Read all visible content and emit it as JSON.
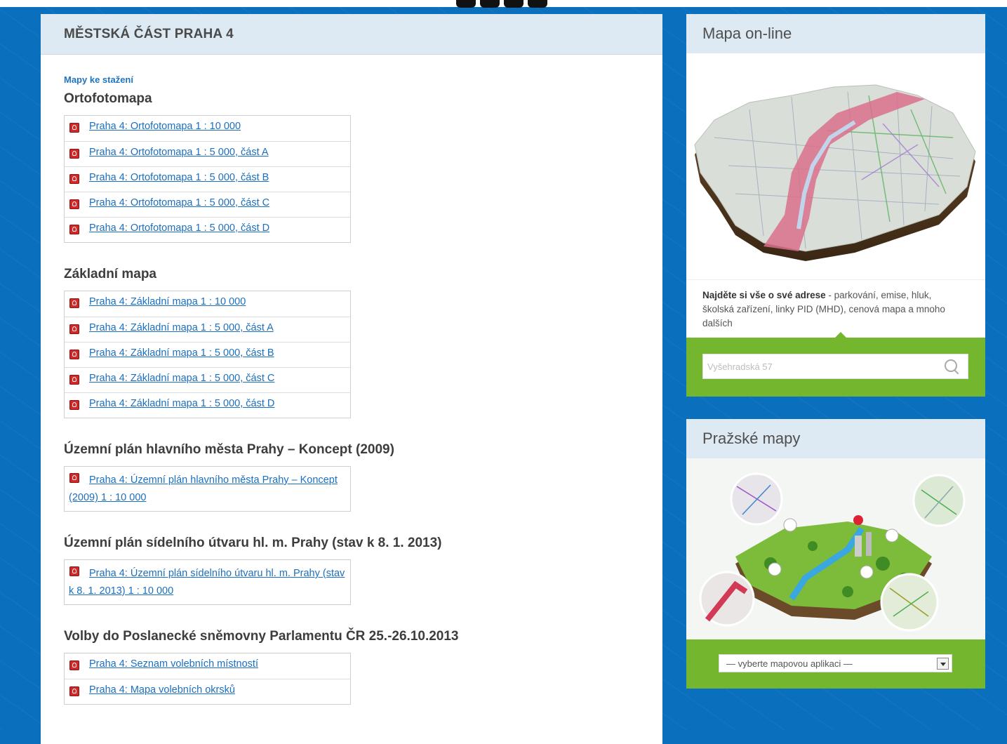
{
  "main": {
    "title": "MĚSTSKÁ ČÁST PRAHA 4",
    "breadcrumb": "Mapy ke stažení",
    "sections": [
      {
        "title": "Ortofotomapa",
        "files": [
          "Praha 4: Ortofotomapa 1 : 10 000",
          "Praha 4: Ortofotomapa 1 : 5 000, část A",
          "Praha 4: Ortofotomapa 1 : 5 000, část B",
          "Praha 4: Ortofotomapa 1 : 5 000, část C",
          "Praha 4: Ortofotomapa 1 : 5 000, část D"
        ]
      },
      {
        "title": "Základní mapa",
        "files": [
          "Praha 4: Základní mapa 1 : 10 000",
          "Praha 4: Základní mapa 1 : 5 000, část A",
          "Praha 4: Základní mapa 1 : 5 000, část B",
          "Praha 4: Základní mapa 1 : 5 000, část C",
          "Praha 4: Základní mapa 1 : 5 000, část D"
        ]
      },
      {
        "title": "Územní plán hlavního města Prahy – Koncept (2009)",
        "files": [
          "Praha 4: Územní plán hlavního města Prahy – Koncept (2009) 1 : 10 000"
        ]
      },
      {
        "title": "Územní plán sídelního útvaru hl. m. Prahy (stav k 8. 1. 2013)",
        "files": [
          "Praha 4: Územní plán sídelního útvaru hl. m. Prahy (stav k 8. 1. 2013) 1 : 10 000"
        ]
      },
      {
        "title": "Volby do Poslanecké sněmovny Parlamentu ČR 25.-26.10.2013",
        "files": [
          "Praha 4: Seznam volebních místností",
          "Praha 4: Mapa volebních okrsků"
        ]
      }
    ]
  },
  "online_map": {
    "title": "Mapa on-line",
    "desc_bold": "Najděte si vše o své adrese",
    "desc_rest": " - parkování, emise, hluk, školská zařízení, linky PID (MHD), cenová mapa a mnoho dalších",
    "search_placeholder": "Vyšehradská 57"
  },
  "prague_maps": {
    "title": "Pražské mapy",
    "select_value": "— vyberte mapovou aplikaci —"
  },
  "colors": {
    "background": "#0a6fbc",
    "header": "#dde9f3",
    "link": "#1b6fc0",
    "green": "#74b72e"
  }
}
